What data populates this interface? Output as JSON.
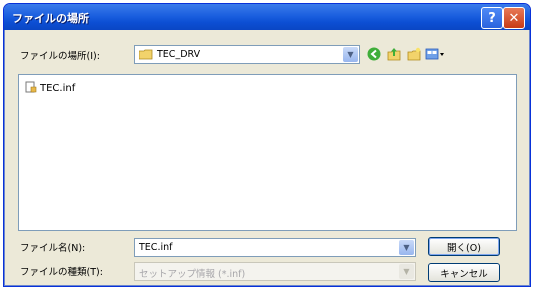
{
  "window": {
    "title": "ファイルの場所"
  },
  "titlebar": {
    "help_label": "?",
    "close_label": "✕"
  },
  "location": {
    "label": "ファイルの場所(I):",
    "value": "TEC_DRV"
  },
  "files": [
    {
      "name": "TEC.inf"
    }
  ],
  "filename": {
    "label": "ファイル名(N):",
    "value": "TEC.inf"
  },
  "filetype": {
    "label": "ファイルの種類(T):",
    "value": "セットアップ情報 (*.inf)"
  },
  "buttons": {
    "open": "開く(O)",
    "cancel": "キャンセル"
  },
  "icons": {
    "back": "back-icon",
    "up": "up-folder-icon",
    "new_folder": "new-folder-icon",
    "views": "views-icon"
  }
}
